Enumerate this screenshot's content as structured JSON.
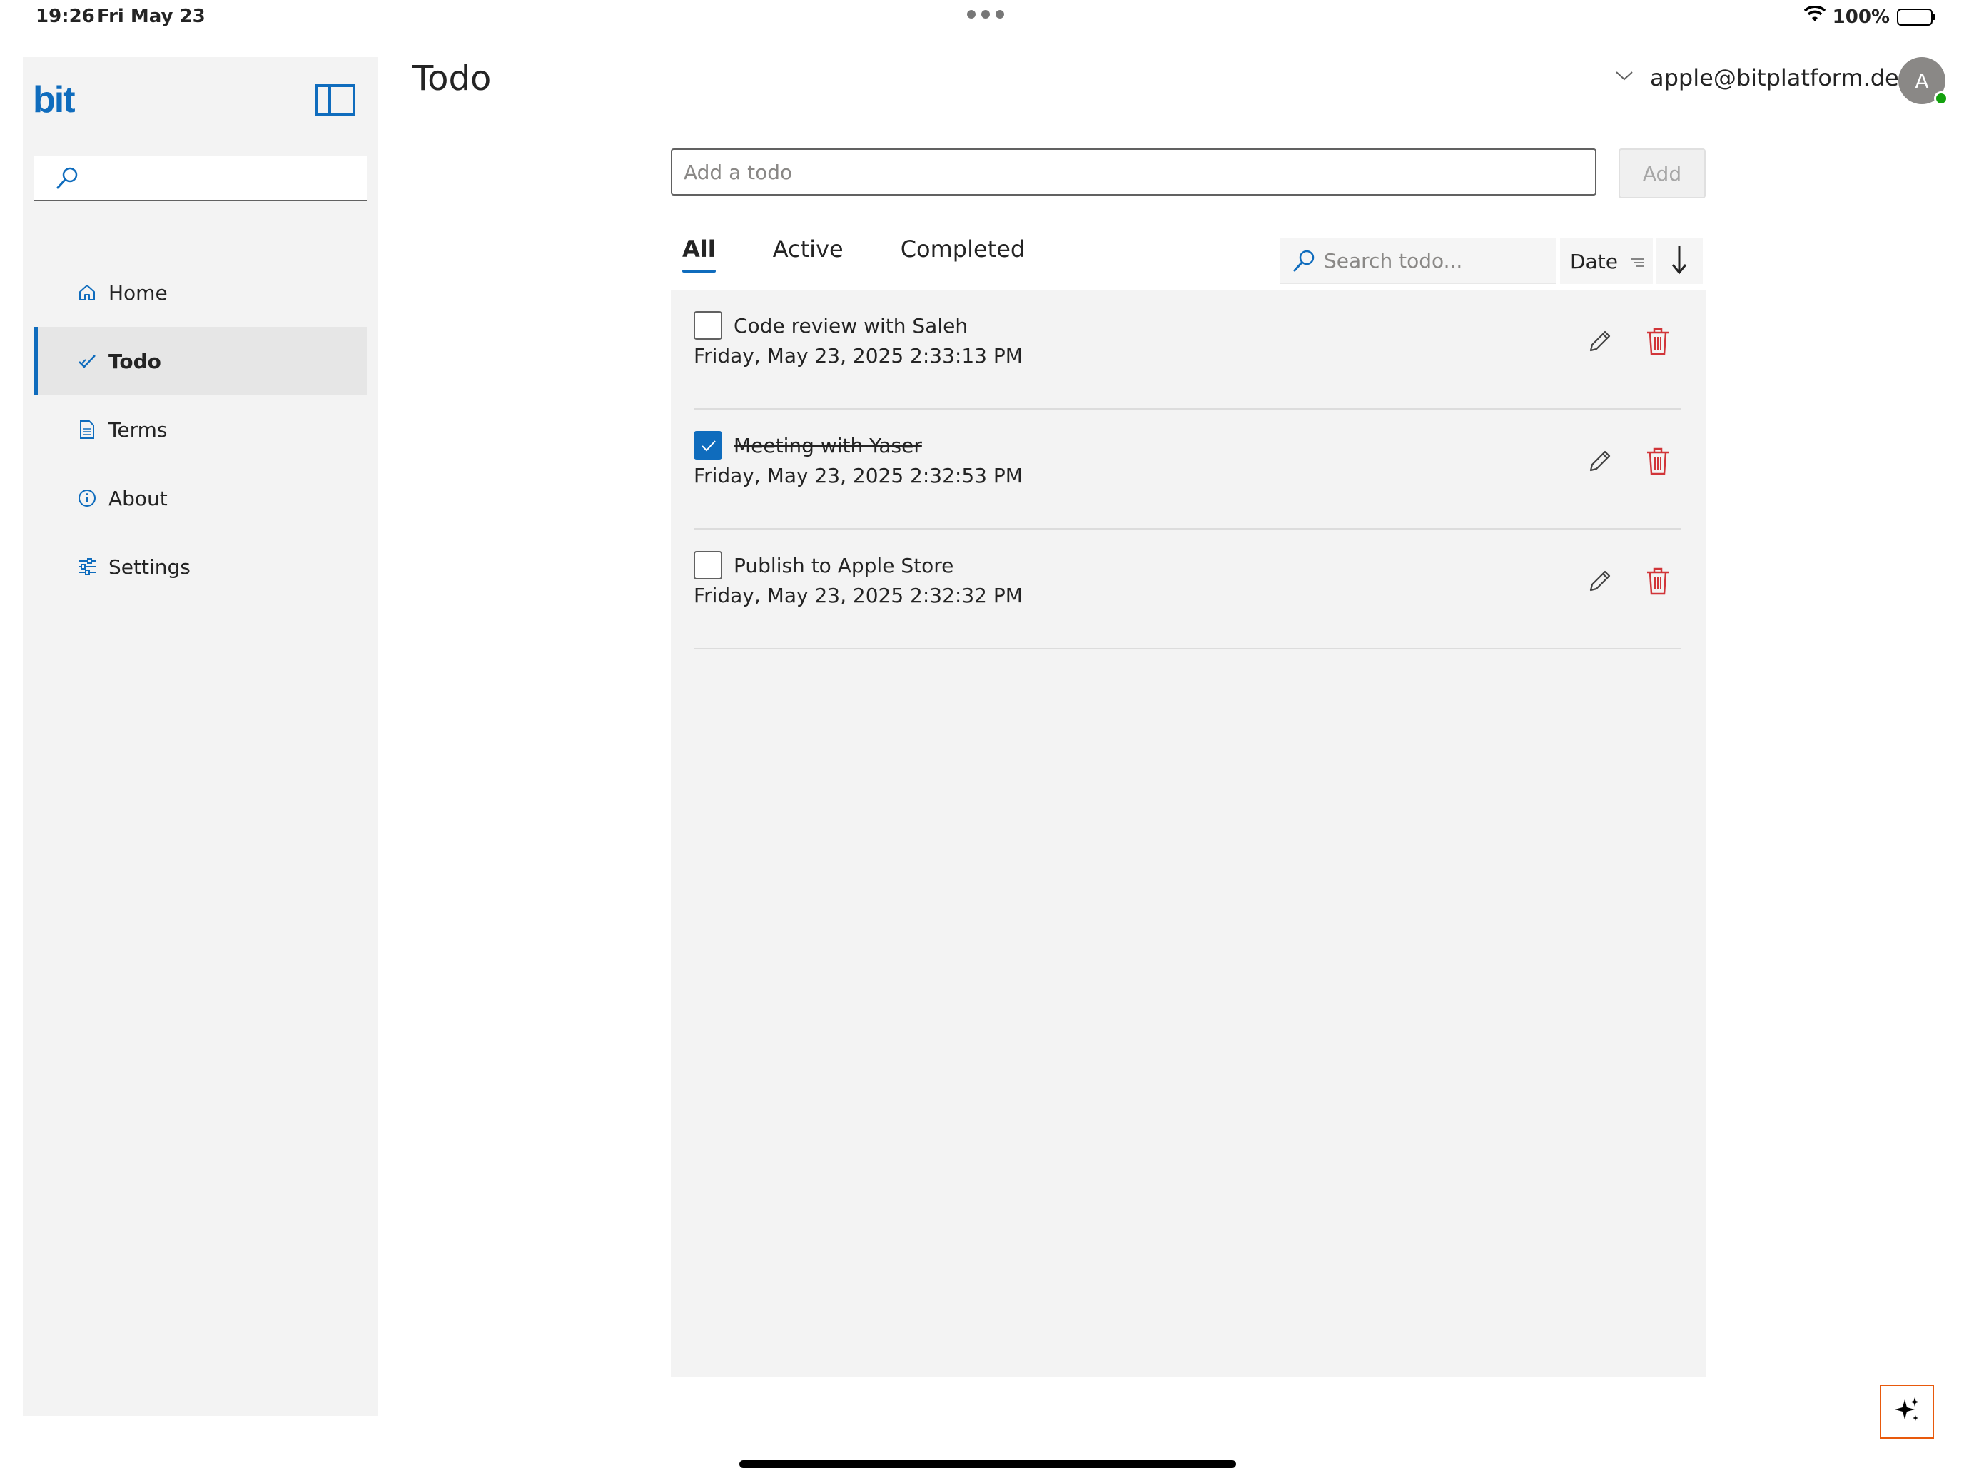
{
  "status_bar": {
    "time": "19:26",
    "date": "Fri May 23",
    "battery": "100%"
  },
  "sidebar": {
    "logo": "bit",
    "items": [
      {
        "label": "Home",
        "icon": "home-icon",
        "active": false
      },
      {
        "label": "Todo",
        "icon": "checkmark-icon",
        "active": true
      },
      {
        "label": "Terms",
        "icon": "document-icon",
        "active": false
      },
      {
        "label": "About",
        "icon": "info-icon",
        "active": false
      },
      {
        "label": "Settings",
        "icon": "sliders-icon",
        "active": false
      }
    ]
  },
  "header": {
    "title": "Todo",
    "user_email": "apple@bitplatform.dev",
    "avatar_initial": "A"
  },
  "add_form": {
    "placeholder": "Add a todo",
    "button_label": "Add"
  },
  "filters": {
    "tabs": [
      {
        "label": "All",
        "active": true
      },
      {
        "label": "Active",
        "active": false
      },
      {
        "label": "Completed",
        "active": false
      }
    ],
    "search_placeholder": "Search todo...",
    "sort_label": "Date"
  },
  "todos": [
    {
      "title": "Code review with Saleh",
      "date": "Friday, May 23, 2025 2:33:13 PM",
      "done": false
    },
    {
      "title": "Meeting with Yaser",
      "date": "Friday, May 23, 2025 2:32:53 PM",
      "done": true
    },
    {
      "title": "Publish to Apple Store",
      "date": "Friday, May 23, 2025 2:32:32 PM",
      "done": false
    }
  ],
  "colors": {
    "accent": "#0f6cbd",
    "danger": "#d13438",
    "sidebar_bg": "#f3f3f3",
    "ai_border": "#e8590c"
  }
}
